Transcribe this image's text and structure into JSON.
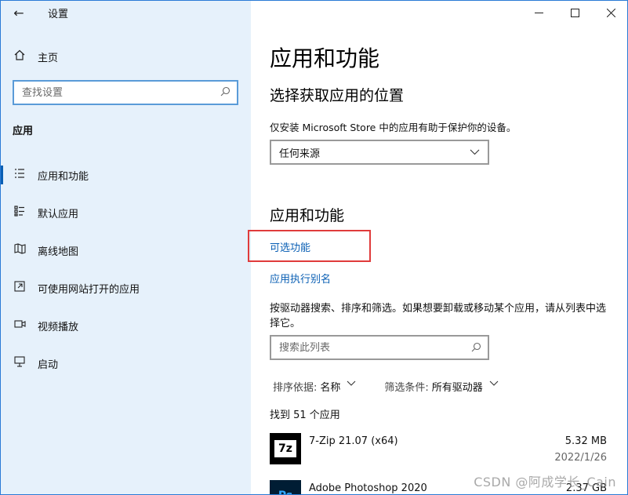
{
  "window": {
    "title": "设置",
    "controls": {
      "minimize": "—",
      "maximize": "☐",
      "close": "✕"
    }
  },
  "sidebar": {
    "back_icon": "←",
    "home": {
      "icon": "home-icon",
      "label": "主页"
    },
    "search": {
      "placeholder": "查找设置"
    },
    "section": "应用",
    "items": [
      {
        "icon": "apps-features-icon",
        "label": "应用和功能",
        "active": true
      },
      {
        "icon": "default-apps-icon",
        "label": "默认应用",
        "active": false
      },
      {
        "icon": "offline-maps-icon",
        "label": "离线地图",
        "active": false
      },
      {
        "icon": "apps-websites-icon",
        "label": "可使用网站打开的应用",
        "active": false
      },
      {
        "icon": "video-playback-icon",
        "label": "视频播放",
        "active": false
      },
      {
        "icon": "startup-icon",
        "label": "启动",
        "active": false
      }
    ]
  },
  "main": {
    "title": "应用和功能",
    "location": {
      "heading": "选择获取应用的位置",
      "description": "仅安装 Microsoft Store 中的应用有助于保护你的设备。",
      "selected": "任何来源"
    },
    "apps": {
      "heading": "应用和功能",
      "link_optional": "可选功能",
      "link_alias": "应用执行别名",
      "filter_description": "按驱动器搜索、排序和筛选。如果想要卸载或移动某个应用，请从列表中选择它。",
      "search_placeholder": "搜索此列表",
      "sort_label": "排序依据:",
      "sort_value": "名称",
      "filter_label": "筛选条件:",
      "filter_value": "所有驱动器",
      "found": "找到 51 个应用",
      "list": [
        {
          "name": "7-Zip 21.07 (x64)",
          "size": "5.32 MB",
          "date": "2022/1/26",
          "icon_text": "7z"
        },
        {
          "name": "Adobe Photoshop 2020",
          "size": "2.37 GB",
          "date": "",
          "icon_text": "Ps"
        }
      ]
    }
  },
  "watermark": "CSDN @阿成学长_Cain"
}
